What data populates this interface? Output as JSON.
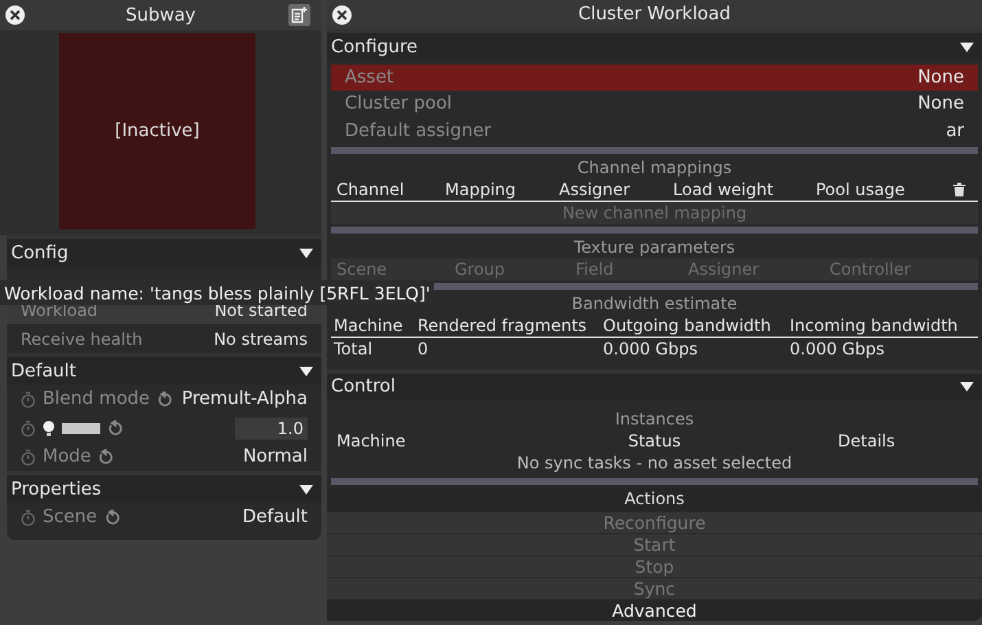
{
  "left_panel": {
    "title": "Subway",
    "preview_label": "[Inactive]",
    "sections": [
      {
        "title": "Config",
        "expanded": true,
        "rows": [
          {
            "kind": "info",
            "label": "Workload",
            "value": "Not started",
            "highlighted": true
          },
          {
            "kind": "info",
            "label": "Receive health",
            "value": "No streams",
            "highlighted": false
          }
        ]
      },
      {
        "title": "Default",
        "expanded": true,
        "rows": [
          {
            "kind": "select",
            "label": "Blend mode",
            "value": "Premult-Alpha"
          },
          {
            "kind": "swatch",
            "value": "1.0"
          },
          {
            "kind": "select",
            "label": "Mode",
            "value": "Normal"
          }
        ]
      },
      {
        "title": "Properties",
        "expanded": true,
        "rows": [
          {
            "kind": "select",
            "label": "Scene",
            "value": "Default"
          }
        ]
      }
    ]
  },
  "tooltip": "Workload name: 'tangs bless plainly [5RFL 3ELQ]'",
  "right_panel": {
    "title": "Cluster Workload",
    "configure": {
      "title": "Configure",
      "expanded": true,
      "rows": [
        {
          "label": "Asset",
          "value": "None",
          "selected": true
        },
        {
          "label": "Cluster pool",
          "value": "None",
          "selected": false
        },
        {
          "label": "Default assigner",
          "value": "ar",
          "selected": false
        }
      ],
      "channel_mappings": {
        "title": "Channel mappings",
        "columns": [
          "Channel",
          "Mapping",
          "Assigner",
          "Load weight",
          "Pool usage"
        ],
        "add_button": "New channel mapping"
      },
      "texture_parameters": {
        "title": "Texture parameters",
        "columns": [
          "Scene",
          "Group",
          "Field",
          "Assigner",
          "Controller"
        ],
        "disabled": true
      },
      "bandwidth": {
        "title": "Bandwidth estimate",
        "columns": [
          "Machine",
          "Rendered fragments",
          "Outgoing bandwidth",
          "Incoming bandwidth"
        ],
        "rows": [
          [
            "Total",
            "0",
            "0.000 Gbps",
            "0.000 Gbps"
          ]
        ]
      }
    },
    "control": {
      "title": "Control",
      "expanded": true,
      "instances": {
        "title": "Instances",
        "columns": [
          "Machine",
          "Status",
          "Details"
        ],
        "empty_message": "No sync tasks - no asset selected"
      },
      "actions": {
        "title": "Actions",
        "buttons": [
          {
            "label": "Reconfigure",
            "disabled": true
          },
          {
            "label": "Start",
            "disabled": true
          },
          {
            "label": "Stop",
            "disabled": true
          },
          {
            "label": "Sync",
            "disabled": true
          },
          {
            "label": "Advanced",
            "disabled": false
          }
        ]
      }
    }
  }
}
